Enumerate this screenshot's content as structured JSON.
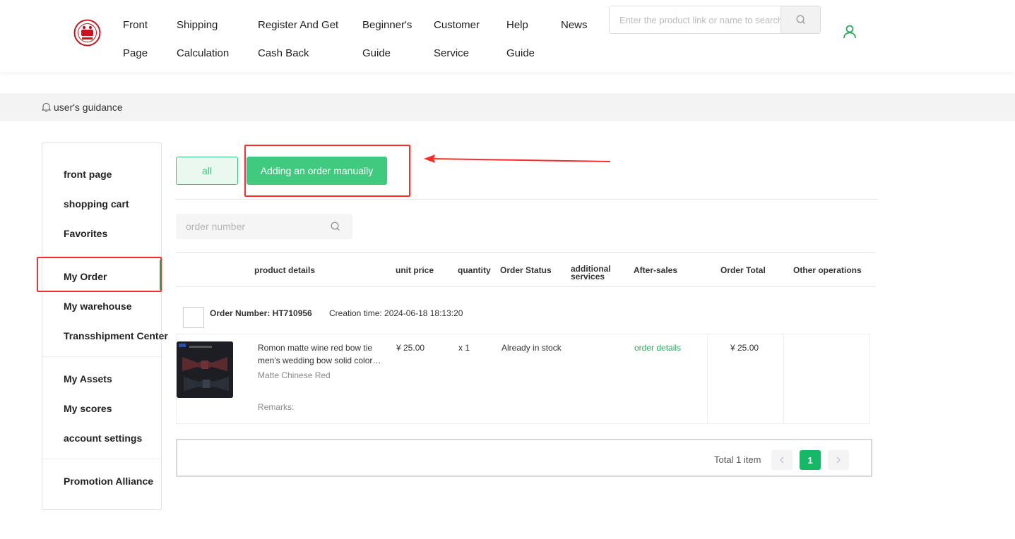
{
  "header": {
    "nav": [
      {
        "line1": "Front",
        "line2": "Page"
      },
      {
        "line1": "Shipping",
        "line2": "Calculation"
      },
      {
        "line1": "Register And Get",
        "line2": "Cash Back"
      },
      {
        "line1": "Beginner's",
        "line2": "Guide"
      },
      {
        "line1": "Customer",
        "line2": "Service"
      },
      {
        "line1": "Help",
        "line2": "Guide"
      },
      {
        "line1": "News",
        "line2": ""
      }
    ],
    "search_placeholder": "Enter the product link or name to search",
    "search_icon": "search-icon",
    "user_icon": "user-icon",
    "logo_icon": "logo-seal"
  },
  "guidance": {
    "text": "user's guidance",
    "icon": "bell-icon"
  },
  "sidebar": {
    "items": [
      "front page",
      "shopping cart",
      "Favorites",
      "My Order",
      "My warehouse",
      "Transshipment Center",
      "My Assets",
      "My scores",
      "account settings",
      "Promotion Alliance"
    ],
    "active": "My Order",
    "accent_color": "#3fb56b"
  },
  "tabs": {
    "all": "all",
    "add_manual": "Adding an order manually"
  },
  "order_search": {
    "placeholder": "order number"
  },
  "table": {
    "columns": [
      "product details",
      "unit price",
      "quantity",
      "Order Status",
      "additional services",
      "After-sales",
      "Order Total",
      "Other operations"
    ]
  },
  "order": {
    "number_label": "Order Number: HT710956",
    "creation_time": "Creation time: 2024-06-18 18:13:20",
    "product": {
      "title": "Romon matte wine red bow tie men's wedding bow solid color…",
      "variant": "Matte Chinese Red",
      "remarks": "Remarks:",
      "unit_price": "¥ 25.00",
      "quantity": "x 1",
      "status": "Already in stock",
      "after_sales": "order details",
      "order_total": "¥ 25.00"
    }
  },
  "pagination": {
    "total": "Total 1 item",
    "current": "1"
  },
  "colors": {
    "primary_green": "#3fca80",
    "annotation_red": "#ff2a2a"
  }
}
